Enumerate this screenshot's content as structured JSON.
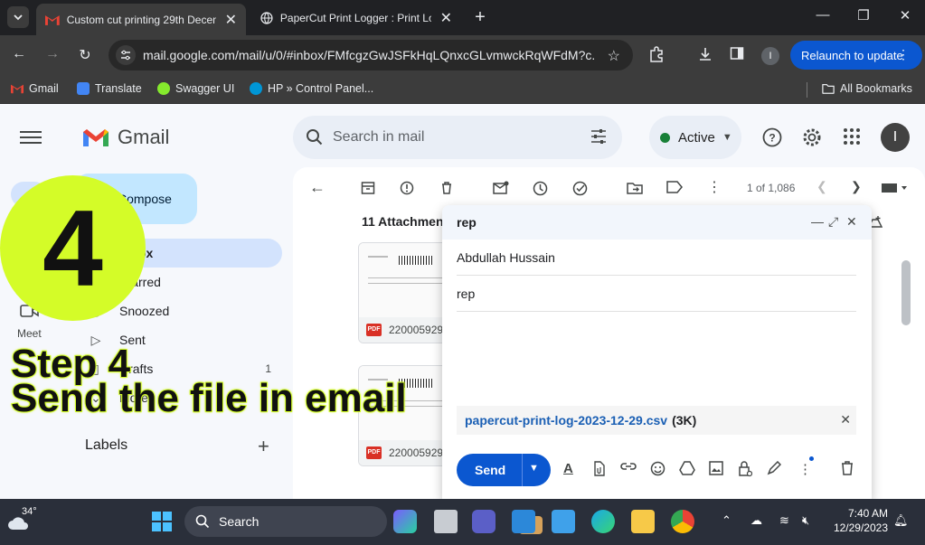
{
  "browser": {
    "tabs": [
      {
        "title": "Custom cut printing 29th Decem",
        "active": true
      },
      {
        "title": "PaperCut Print Logger : Print Lo",
        "active": false
      }
    ],
    "url": "mail.google.com/mail/u/0/#inbox/FMfcgzGwJSFkHqLQnxcGLvmwckRqWFdM?c...",
    "profile_initial": "I",
    "relaunch_label": "Relaunch to update",
    "bookmarks": [
      "Gmail",
      "Translate",
      "Swagger UI",
      "HP » Control Panel..."
    ],
    "all_bookmarks": "All Bookmarks"
  },
  "gmail": {
    "wordmark": "Gmail",
    "search_placeholder": "Search in mail",
    "status": "Active",
    "avatar_initial": "I",
    "compose_label": "Compose",
    "nav": [
      {
        "label": "Inbox",
        "count": ""
      },
      {
        "label": "Starred",
        "count": ""
      },
      {
        "label": "Snoozed",
        "count": ""
      },
      {
        "label": "Sent",
        "count": ""
      },
      {
        "label": "Drafts",
        "count": "1"
      },
      {
        "label": "More",
        "count": ""
      }
    ],
    "meet_label": "Meet",
    "labels_heading": "Labels",
    "pager": "1 of 1,086",
    "attachments_heading": "11 Attachments",
    "attachments": [
      {
        "name": "220005929"
      },
      {
        "name": "220005929"
      }
    ]
  },
  "compose": {
    "title": "rep",
    "to": "Abdullah Hussain",
    "subject": "rep",
    "attachment_name": "papercut-print-log-2023-12-29.csv",
    "attachment_size": "(3K)",
    "send_label": "Send"
  },
  "overlay": {
    "step_number": "4",
    "line1": "Step 4",
    "line2": "Send the file in email",
    "accent": "#d4fc28"
  },
  "taskbar": {
    "temperature": "34°",
    "search_label": "Search",
    "time": "7:40 AM",
    "date": "12/29/2023"
  }
}
